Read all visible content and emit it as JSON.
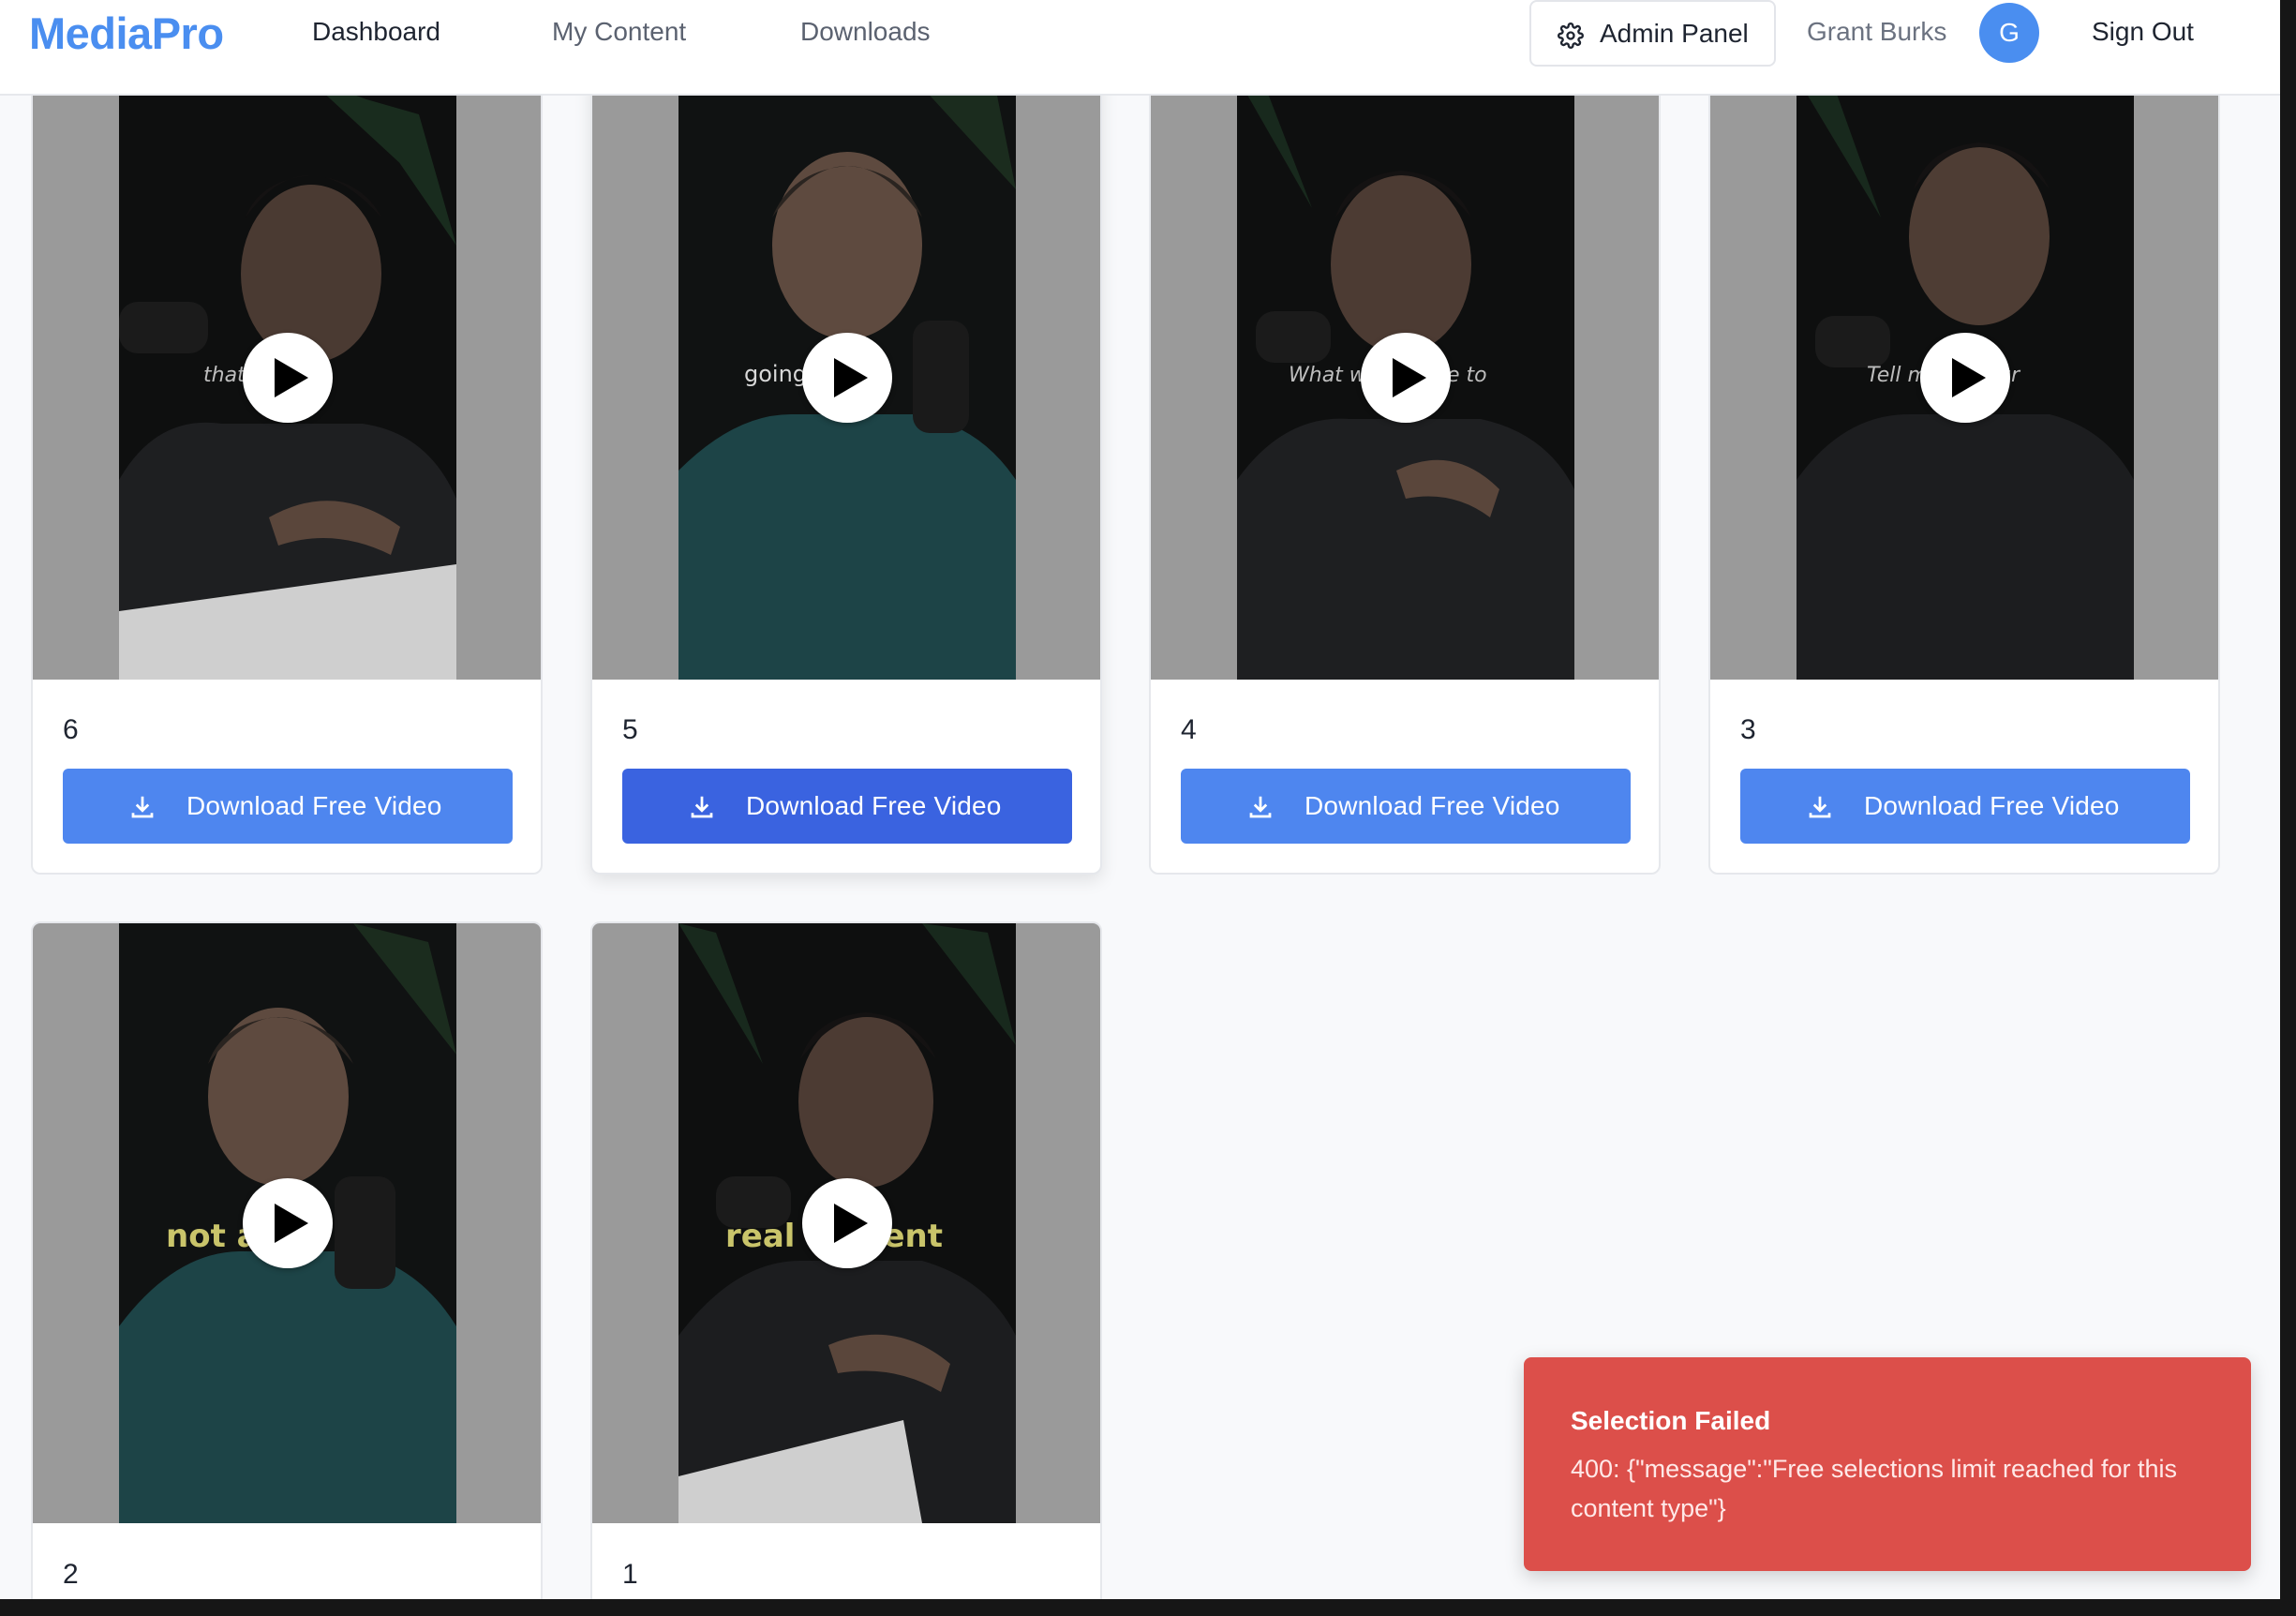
{
  "app": {
    "logo": "MediaPro"
  },
  "nav": {
    "links": [
      "Dashboard",
      "My Content",
      "Downloads"
    ],
    "admin_label": "Admin Panel",
    "user_name": "Grant Burks",
    "avatar_initial": "G",
    "sign_out": "Sign Out"
  },
  "cards": [
    {
      "number": "6",
      "button": "Download Free Video",
      "caption": "that y      rently"
    },
    {
      "number": "5",
      "button": "Download Free Video",
      "caption": "going      t-time"
    },
    {
      "number": "4",
      "button": "Download Free Video",
      "caption": "What wo      vice be to"
    },
    {
      "number": "3",
      "button": "Download Free Video",
      "caption": "Tell me      of your"
    },
    {
      "number": "2",
      "caption": "not al      s"
    },
    {
      "number": "1",
      "caption": "real e      agent"
    }
  ],
  "toast": {
    "title": "Selection Failed",
    "message": "400: {\"message\":\"Free selections limit reached for this content type\"}"
  },
  "colors": {
    "brand": "#4a8ef0",
    "button": "#4e86ef",
    "button_hover": "#3a63e0",
    "toast": "#dc4f4a"
  }
}
